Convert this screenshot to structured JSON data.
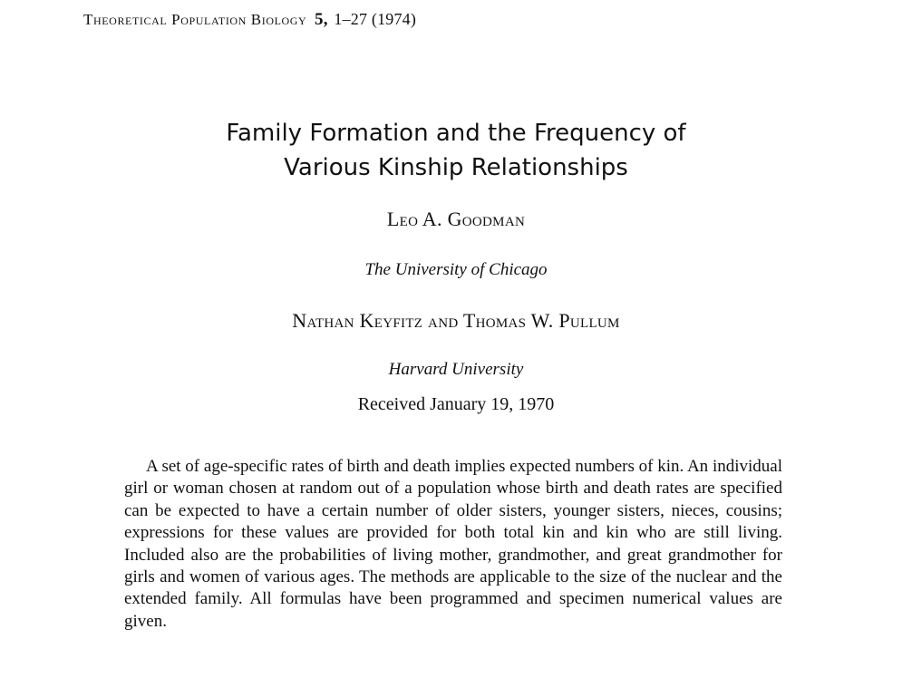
{
  "header": {
    "journal": "Theoretical Population Biology",
    "volume": "5,",
    "pages_year": "1–27 (1974)"
  },
  "title": {
    "line1": "Family Formation and the Frequency of",
    "line2": "Various Kinship Relationships"
  },
  "authors": [
    {
      "names": "Leo A. Goodman",
      "affiliation": "The University of Chicago"
    },
    {
      "names": "Nathan Keyfitz and Thomas W. Pullum",
      "affiliation": "Harvard University"
    }
  ],
  "received": "Received January 19, 1970",
  "abstract": "A set of age-specific rates of birth and death implies expected numbers of kin. An individual girl or woman chosen at random out of a population whose birth and death rates are specified can be expected to have a certain number of older sisters, younger sisters, nieces, cousins; expressions for these values are provided for both total kin and kin who are still living. Included also are the probabilities of living mother, grandmother, and great grandmother for girls and women of various ages. The methods are applicable to the size of the nuclear and the extended family. All formulas have been programmed and specimen numerical values are given."
}
